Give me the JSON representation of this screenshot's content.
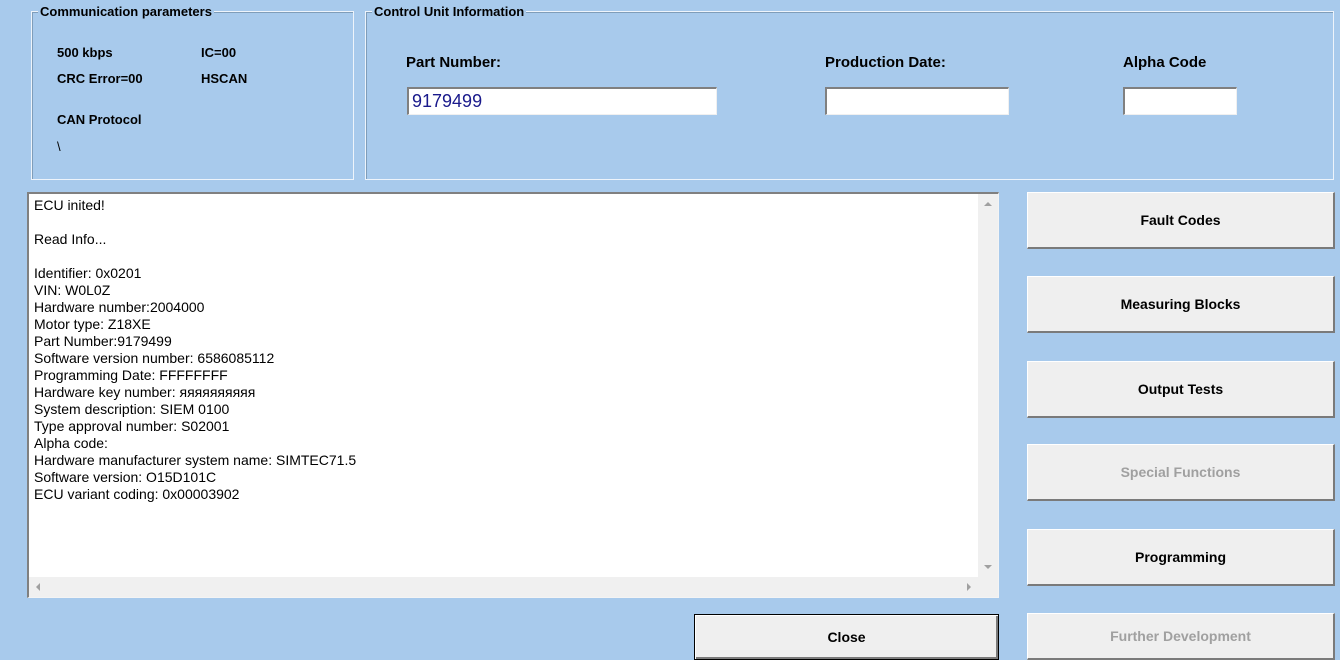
{
  "comm_params": {
    "title": "Communication parameters",
    "speed": "500 kbps",
    "ic": "IC=00",
    "crc_error": "CRC Error=00",
    "bus": "HSCAN",
    "protocol": "CAN Protocol",
    "extra": "\\"
  },
  "control_unit": {
    "title": "Control Unit Information",
    "part_number_label": "Part Number:",
    "part_number_value": "9179499",
    "production_date_label": "Production Date:",
    "production_date_value": "",
    "alpha_code_label": "Alpha Code",
    "alpha_code_value": ""
  },
  "log": {
    "lines": [
      "ECU inited!",
      "",
      "Read Info...",
      "",
      "Identifier: 0x0201",
      "VIN: W0L0Z",
      "Hardware number:2004000",
      "Motor type: Z18XE",
      "Part Number:9179499",
      "Software version number: 6586085112",
      "Programming Date: FFFFFFFF",
      "Hardware key number: яяяяяяяяяя",
      "System description: SIEM 0100",
      "Type approval number: S02001",
      "Alpha code:",
      "Hardware manufacturer system name: SIMTEC71.5",
      "Software version: O15D101C",
      "ECU variant coding: 0x00003902"
    ]
  },
  "buttons": {
    "fault_codes": "Fault Codes",
    "measuring_blocks": "Measuring Blocks",
    "output_tests": "Output Tests",
    "special_functions": "Special Functions",
    "programming": "Programming",
    "further_development": "Further Development",
    "close": "Close"
  }
}
